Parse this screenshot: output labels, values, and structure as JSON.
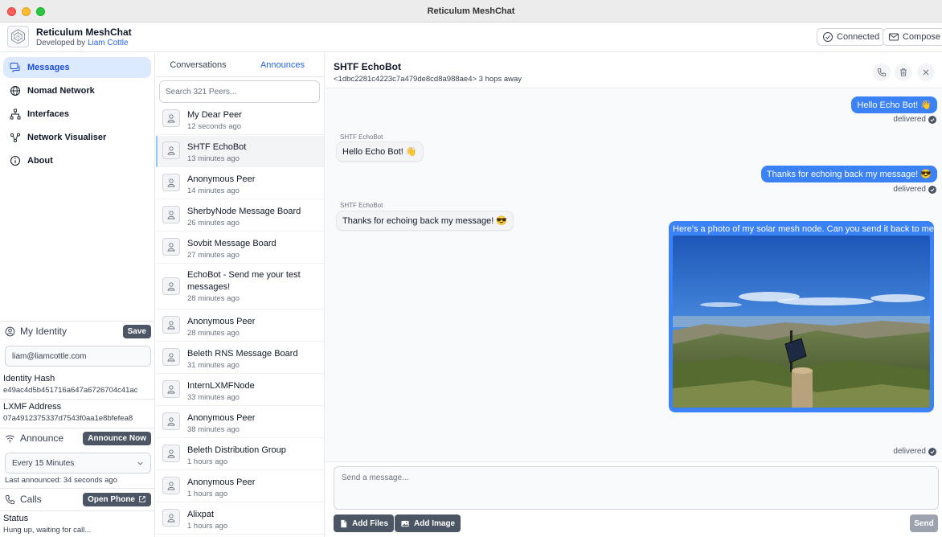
{
  "window": {
    "title": "Reticulum MeshChat"
  },
  "header": {
    "app_name": "Reticulum MeshChat",
    "developed_by": "Developed by",
    "developer": "Liam Cottle",
    "connected_label": "Connected",
    "compose_label": "Compose"
  },
  "sidebar": {
    "items": [
      {
        "label": "Messages",
        "icon": "chat-bubbles-icon",
        "active": true
      },
      {
        "label": "Nomad Network",
        "icon": "globe-icon",
        "active": false
      },
      {
        "label": "Interfaces",
        "icon": "network-nodes-icon",
        "active": false
      },
      {
        "label": "Network Visualiser",
        "icon": "graph-icon",
        "active": false
      },
      {
        "label": "About",
        "icon": "info-icon",
        "active": false
      }
    ],
    "identity": {
      "heading": "My Identity",
      "save_label": "Save",
      "display_name": "liam@liamcottle.com",
      "hash_label": "Identity Hash",
      "hash_value": "e49ac4d5b451716a647a6726704c41ac",
      "lxmf_label": "LXMF Address",
      "lxmf_value": "07a4912375337d7543f0aa1e8bfefea8"
    },
    "announce": {
      "heading": "Announce",
      "button": "Announce Now",
      "interval": "Every 15 Minutes",
      "last": "Last announced: 34 seconds ago"
    },
    "calls": {
      "heading": "Calls",
      "button": "Open Phone",
      "status_label": "Status",
      "status_value": "Hung up, waiting for call..."
    }
  },
  "peers": {
    "tabs": [
      {
        "label": "Conversations",
        "active": false
      },
      {
        "label": "Announces",
        "active": true
      }
    ],
    "search_placeholder": "Search 321 Peers...",
    "list": [
      {
        "name": "My Dear Peer",
        "time": "12 seconds ago"
      },
      {
        "name": "SHTF EchoBot",
        "time": "13 minutes ago",
        "selected": true
      },
      {
        "name": "Anonymous Peer",
        "time": "14 minutes ago"
      },
      {
        "name": "SherbyNode Message Board",
        "time": "26 minutes ago"
      },
      {
        "name": "Sovbit Message Board",
        "time": "27 minutes ago"
      },
      {
        "name": "EchoBot - Send me your test messages!",
        "time": "28 minutes ago"
      },
      {
        "name": "Anonymous Peer",
        "time": "28 minutes ago"
      },
      {
        "name": "Beleth RNS Message Board",
        "time": "31 minutes ago"
      },
      {
        "name": "InternLXMFNode",
        "time": "33 minutes ago"
      },
      {
        "name": "Anonymous Peer",
        "time": "38 minutes ago"
      },
      {
        "name": "Beleth Distribution Group",
        "time": "1 hours ago"
      },
      {
        "name": "Anonymous Peer",
        "time": "1 hours ago"
      },
      {
        "name": "Alixpat",
        "time": "1 hours ago"
      }
    ]
  },
  "chat": {
    "peer_name": "SHTF EchoBot",
    "peer_info": "<1dbc2281c4223c7a479de8cd8a988ae4> 3 hops away",
    "messages": [
      {
        "direction": "out",
        "text": "Hello Echo Bot! 👋",
        "status": "delivered"
      },
      {
        "direction": "in",
        "sender": "SHTF EchoBot",
        "text": "Hello Echo Bot! 👋"
      },
      {
        "direction": "out",
        "text": "Thanks for echoing back my message! 😎",
        "status": "delivered"
      },
      {
        "direction": "in",
        "sender": "SHTF EchoBot",
        "text": "Thanks for echoing back my message! 😎"
      },
      {
        "direction": "out",
        "text": "Here's a photo of my solar mesh node. Can you send it back to me?",
        "status": "delivered",
        "has_image": true
      }
    ],
    "composer": {
      "placeholder": "Send a message...",
      "add_files": "Add Files",
      "add_image": "Add Image",
      "send": "Send"
    }
  },
  "colors": {
    "accent": "#3b82f6",
    "active_nav_bg": "#dbeafe",
    "dark_button": "#4b5563"
  }
}
